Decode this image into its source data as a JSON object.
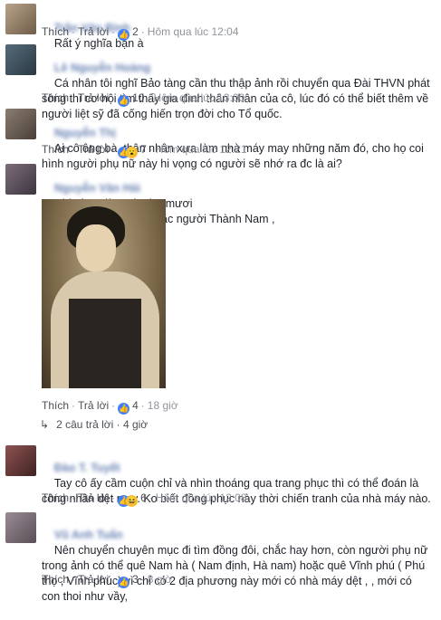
{
  "ui": {
    "like": "Thích",
    "reply": "Trả lời",
    "sep": "·"
  },
  "comments": [
    {
      "name": "Trần Văn Bình",
      "text": "Rất ý nghĩa bạn à",
      "likes": "2",
      "time": "Hôm qua lúc 12:04"
    },
    {
      "name": "Lê Nguyễn Hoàng",
      "text": "Cá nhân tôi nghĩ Bảo tàng cần thu thập ảnh rồi chuyển qua Đài THVN phát sóng thì cơ hội tìm thấy gia đình thân nhân của cô, lúc đó có thể biết thêm về người liệt sỹ đã cống hiến trọn đời cho Tổ quốc.",
      "likes": "10",
      "time": "Hôm qua lúc 13:00"
    },
    {
      "name": "Nguyễn Thị",
      "text": "Ai cô ông bà, thân nhân xưa làm nhà máy may những năm đó, cho họ coi hình người phụ nữ này hi vọng có người sẽ nhớ ra đc là ai?",
      "likes": "7",
      "time": "Hôm qua lúc 12:21"
    },
    {
      "name": "Nguyễn Văn Hải",
      "text": "Chị còn ,giờ ngót tám mươi\nChắc công nhân dệt ,chắc người Thành Nam ,",
      "likes": "4",
      "time": "18 giờ"
    },
    {
      "name": "Đào T. Tuyết",
      "text": "Tay cô ấy cầm cuộn chỉ và nhìn thoáng qua trang phục thì có thể đoán là công nhân dệt may. Ko biết đồng phục này thời chiến tranh của nhà máy nào.",
      "likes": "6",
      "time": "Hôm qua lúc 12:08"
    },
    {
      "name": "Vũ Anh Tuấn",
      "text": "Nên chuyển chuyên mục đi tìm đồng đôi, chắc hay hơn, còn người phụ nữ trong ảnh có thể quê Nam hà ( Nam định, Hà nam) hoặc quê Vĩnh phú ( Phú thọ , Vĩnh phúc) vì chỉ có 2 địa phương này mới có nhà máy dệt , , mới có con thoi như vầy,",
      "likes": "3",
      "time": "8 giờ"
    }
  ],
  "replies_link": "2 câu trả lời · 4 giờ"
}
